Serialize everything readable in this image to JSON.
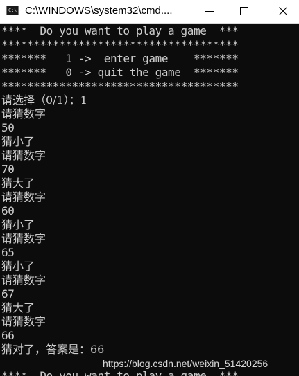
{
  "window": {
    "title": "C:\\WINDOWS\\system32\\cmd....",
    "app_icon_text": "C:\\"
  },
  "console": {
    "lines": [
      "****  Do you want to play a game  ***",
      "*************************************",
      "*******   1 ->  enter game    *******",
      "*******   0 -> quit the game  *******",
      "*************************************",
      "请选择（0/1）：1",
      "请猜数字",
      "50",
      "猜小了",
      "请猜数字",
      "70",
      "猜大了",
      "请猜数字",
      "60",
      "猜小了",
      "请猜数字",
      "65",
      "猜小了",
      "请猜数字",
      "67",
      "猜大了",
      "请猜数字",
      "66",
      "猜对了，答案是：66",
      "****  Do you want to play a game  ***"
    ]
  },
  "watermark": "https://blog.csdn.net/weixin_51420256"
}
